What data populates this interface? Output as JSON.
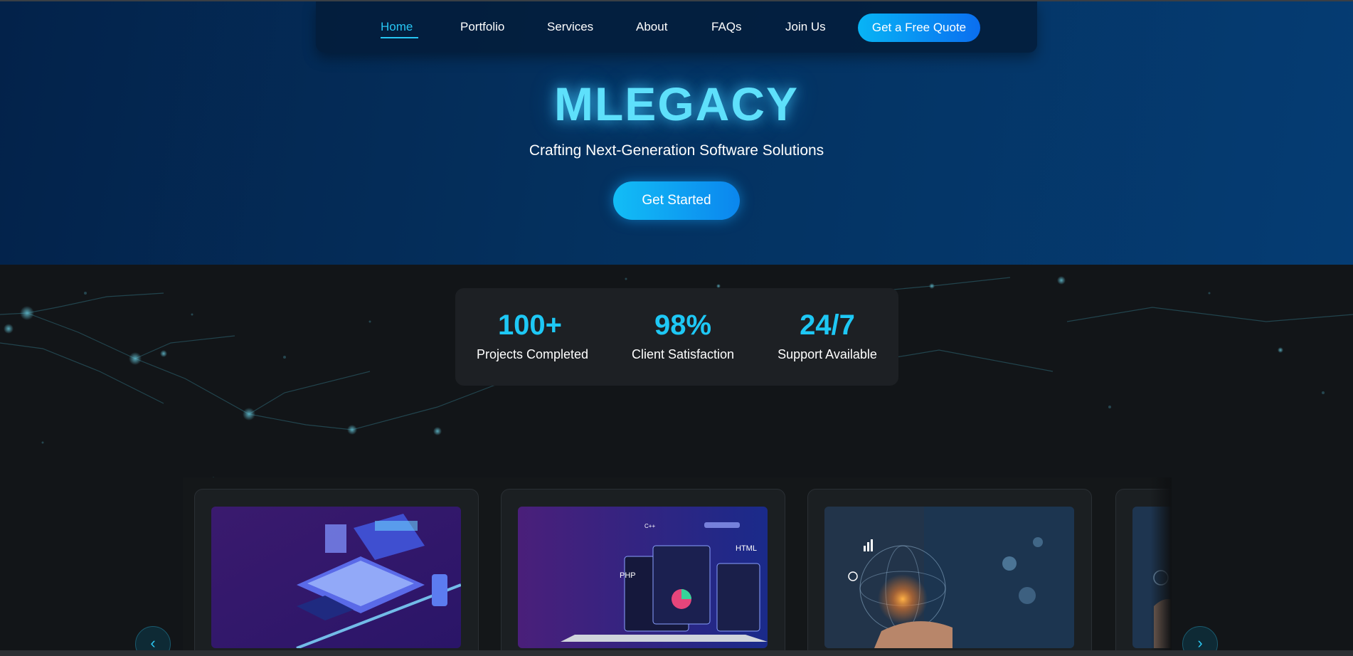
{
  "nav": {
    "links": [
      {
        "label": "Home",
        "active": true
      },
      {
        "label": "Portfolio",
        "active": false
      },
      {
        "label": "Services",
        "active": false
      },
      {
        "label": "About",
        "active": false
      },
      {
        "label": "FAQs",
        "active": false
      },
      {
        "label": "Join Us",
        "active": false
      }
    ],
    "cta_label": "Get a Free Quote"
  },
  "hero": {
    "title": "MLEGACY",
    "subtitle": "Crafting Next-Generation Software Solutions",
    "button_label": "Get Started"
  },
  "stats": [
    {
      "value": "100+",
      "label": "Projects Completed"
    },
    {
      "value": "98%",
      "label": "Client Satisfaction"
    },
    {
      "value": "24/7",
      "label": "Support Available"
    }
  ],
  "carousel": {
    "prev_icon": "chevron-left-icon",
    "next_icon": "chevron-right-icon",
    "prev_glyph": "‹",
    "next_glyph": "›",
    "image_labels": {
      "card2_php": "PHP",
      "card2_html": "HTML",
      "card2_cpp": "C++"
    }
  },
  "colors": {
    "accent": "#1ec8f5",
    "hero_bg": "#04315f",
    "page_bg": "#121518",
    "card_bg": "#1b1f22"
  }
}
